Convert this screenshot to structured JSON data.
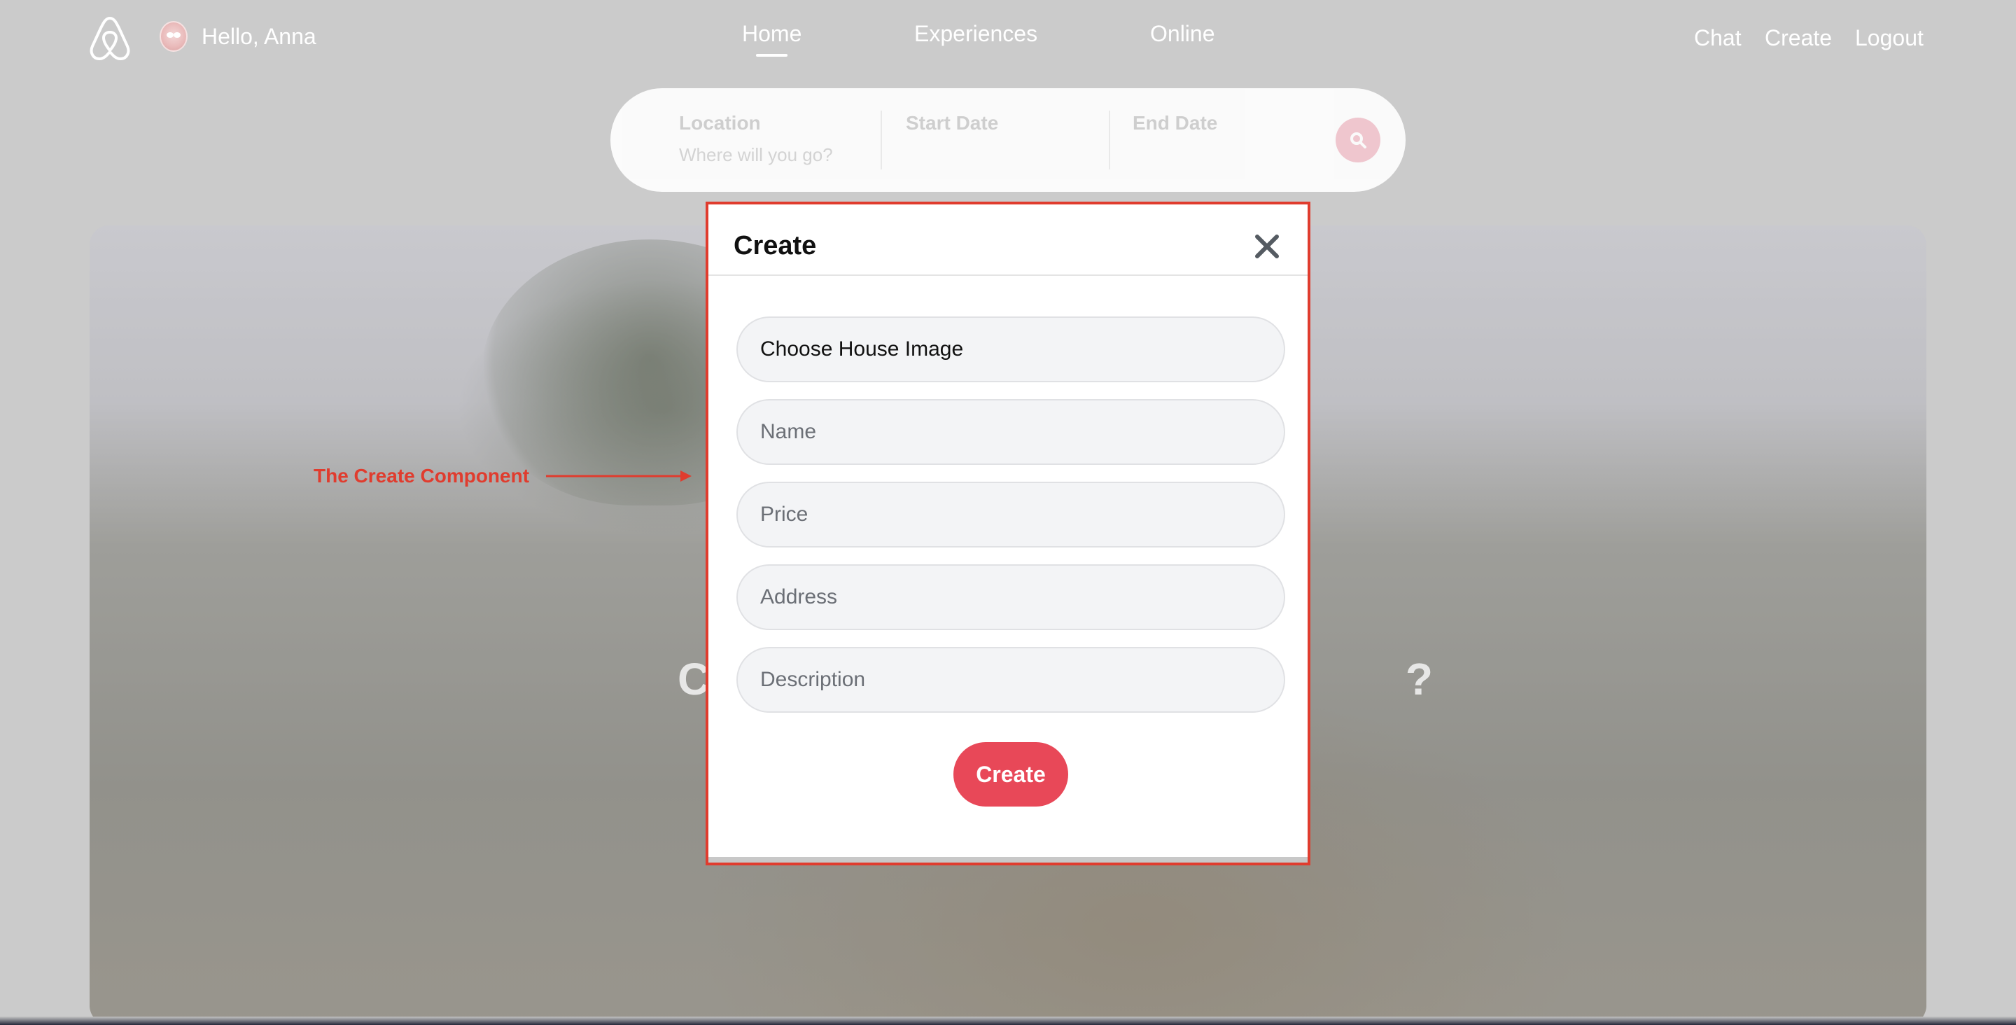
{
  "nav": {
    "greeting": "Hello, Anna",
    "links": [
      "Home",
      "Experiences",
      "Online"
    ],
    "right": {
      "chat": "Chat",
      "create": "Create",
      "logout": "Logout"
    },
    "active_link": "Home"
  },
  "search": {
    "location_label": "Location",
    "location_placeholder": "Where will you go?",
    "start_label": "Start Date",
    "end_label": "End Date",
    "button_icon": "search-icon"
  },
  "modal": {
    "title": "Create",
    "close_icon": "close-icon",
    "image_label": "Choose House Image",
    "name_placeholder": "Name",
    "price_placeholder": "Price",
    "address_placeholder": "Address",
    "description_placeholder": "Description",
    "submit_label": "Create"
  },
  "annotation": {
    "text": "The Create Component"
  },
  "colors": {
    "accent": "#e84858",
    "annotation": "#e03c2e",
    "overlay": "#cbcbcb"
  }
}
